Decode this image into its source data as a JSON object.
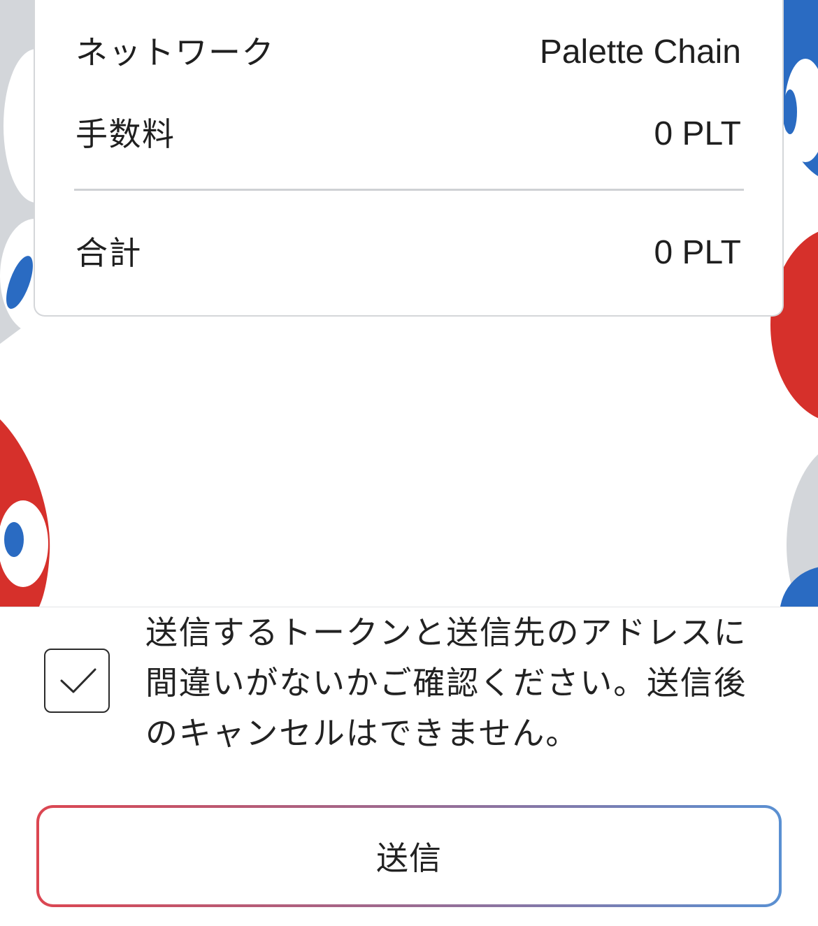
{
  "summary": {
    "rows": [
      {
        "label": "ネットワーク",
        "value": "Palette Chain"
      },
      {
        "label": "手数料",
        "value": "0 PLT"
      }
    ],
    "total": {
      "label": "合計",
      "value": "0 PLT"
    }
  },
  "confirm": {
    "checked": true,
    "icon": "checkmark-icon",
    "text": "送信するトークンと送信先のアドレスに間違いがないかご確認ください。送信後のキャンセルはできません。"
  },
  "submit": {
    "label": "送信"
  },
  "colors": {
    "button_gradient_start": "#dc4651",
    "button_gradient_end": "#5a90d2",
    "decor_red": "#d6302b",
    "decor_blue": "#2a6bc2",
    "decor_gray": "#d3d6da"
  }
}
